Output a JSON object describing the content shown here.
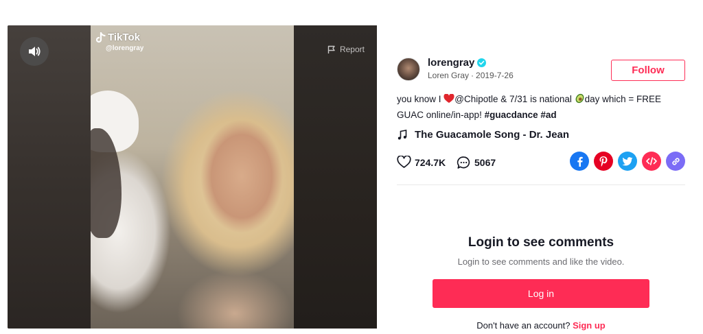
{
  "video": {
    "overlay_brand": "TikTok",
    "overlay_handle": "@lorengray",
    "report_label": "Report"
  },
  "author": {
    "username": "lorengray",
    "display_name": "Loren Gray",
    "date": "2019-7-26",
    "follow_label": "Follow"
  },
  "description": {
    "text_1": "you know I ",
    "text_2": "@Chipotle & 7/31 is national ",
    "text_3": "day which = FREE GUAC online/in-app! ",
    "hashtag_1": "#guacdance",
    "hashtag_2": "#ad"
  },
  "music": {
    "title": "The Guacamole Song - Dr. Jean"
  },
  "stats": {
    "likes": "724.7K",
    "comments": "5067"
  },
  "share_icons": [
    "facebook-icon",
    "pinterest-icon",
    "twitter-icon",
    "embed-icon",
    "link-icon"
  ],
  "colors": {
    "accent": "#fe2c55",
    "verified": "#20d5ec",
    "facebook": "#1877f2",
    "pinterest": "#e60023",
    "twitter": "#1da1f2",
    "embed": "#fe2c55",
    "link": "#7b6cf6"
  },
  "login": {
    "title": "Login to see comments",
    "subtitle": "Login to see comments and like the video.",
    "button_label": "Log in",
    "signup_prompt": "Don't have an account?",
    "signup_link": "Sign up"
  }
}
